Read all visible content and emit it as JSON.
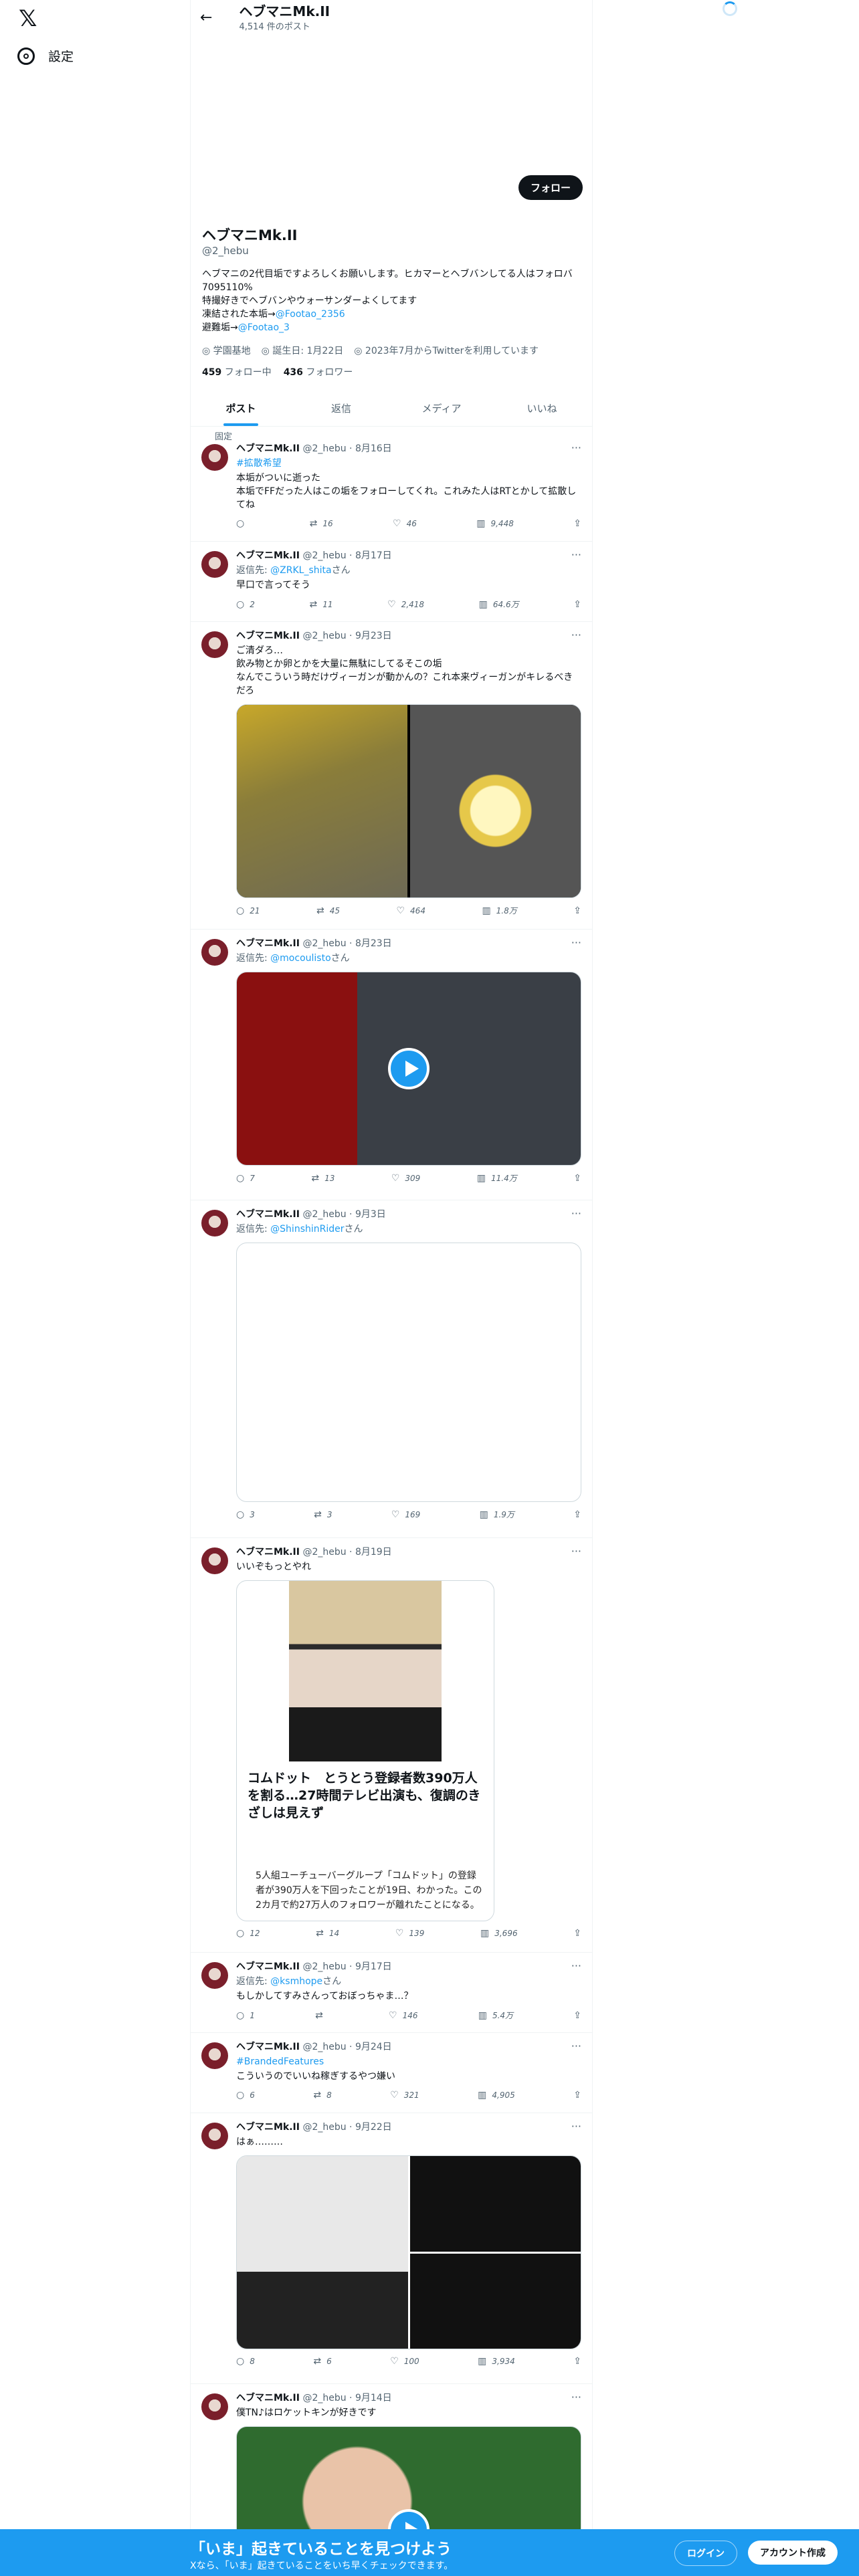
{
  "nav": {
    "logo": "𝕏",
    "settings": "設定"
  },
  "header": {
    "back": "←",
    "name": "ヘブマニMk.II",
    "count": "4,514 件のポスト"
  },
  "profile": {
    "follow": "フォロー",
    "name": "ヘブマニMk.II",
    "handle": "@2_hebu",
    "bio1": "ヘブマニの2代目垢ですよろしくお願いします。ヒカマーとヘブバンしてる人はフォロバ7095110%\n特撮好きでヘブバンやウォーサンダーよくしてます\n凍結された本垢→",
    "bio_link1": "@Footao_2356",
    "bio2": "避難垢→",
    "bio_link2": "@Footao_3",
    "loc": "学園基地",
    "born": "誕生日: 1月22日",
    "joined": "2023年7月からTwitterを利用しています",
    "following_num": "459",
    "following_label": "フォロー中",
    "followers_num": "436",
    "followers_label": "フォロワー"
  },
  "tabs": [
    "ポスト",
    "返信",
    "メディア",
    "いいね"
  ],
  "pinned": "固定",
  "tweets": [
    {
      "name": "ヘブマニMk.II",
      "meta": "@2_hebu · 8月16日",
      "hashtag": "#拡散希望",
      "text": "本垢がついに逝った\n本垢でFFだった人はこの垢をフォローしてくれ。これみた人はRTとかして拡散してね",
      "reply": "",
      "rt": "16",
      "like": "46",
      "view": "9,448"
    },
    {
      "name": "ヘブマニMk.II",
      "meta": "@2_hebu · 8月17日",
      "reply_to": "返信先: ",
      "reply_link": "@ZRKL_shita",
      "reply_suffix": "さん",
      "text": "早口で言ってそう",
      "reply": "2",
      "rt": "11",
      "like": "2,418",
      "view": "64.6万"
    },
    {
      "name": "ヘブマニMk.II",
      "meta": "@2_hebu · 9月23日",
      "text": "ご清ダろ…\n飲み物とか卵とかを大量に無駄にしてるそこの垢\nなんでこういう時だけヴィーガンが動かんの？これ本来ヴィーガンがキレるべきだろ",
      "reply": "21",
      "rt": "45",
      "like": "464",
      "view": "1.8万"
    },
    {
      "name": "ヘブマニMk.II",
      "meta": "@2_hebu · 8月23日",
      "reply_to": "返信先: ",
      "reply_link": "@mocoulisto",
      "reply_suffix": "さん",
      "text": "",
      "reply": "7",
      "rt": "13",
      "like": "309",
      "view": "11.4万"
    },
    {
      "name": "ヘブマニMk.II",
      "meta": "@2_hebu · 9月3日",
      "reply_to": "返信先: ",
      "reply_link": "@ShinshinRider",
      "reply_suffix": "さん",
      "text": "",
      "reply": "3",
      "rt": "3",
      "like": "169",
      "view": "1.9万"
    },
    {
      "name": "ヘブマニMk.II",
      "meta": "@2_hebu · 8月19日",
      "text": "いいぞもっとやれ",
      "card_title": "コムドット　とうとう登録者数390万人を割る…27時間テレビ出演も、復調のきざしは見えず",
      "card_body": "5人組ユーチューバーグループ「コムドット」の登録者が390万人を下回ったことが19日、わかった。この2カ月で約27万人のフォロワーが離れたことになる。",
      "reply": "12",
      "rt": "14",
      "like": "139",
      "view": "3,696"
    },
    {
      "name": "ヘブマニMk.II",
      "meta": "@2_hebu · 9月17日",
      "reply_to": "返信先: ",
      "reply_link": "@ksmhope",
      "reply_suffix": "さん",
      "text": "もしかしてすみさんっておぼっちゃま…？",
      "reply": "1",
      "rt": "",
      "like": "146",
      "view": "5.4万"
    },
    {
      "name": "ヘブマニMk.II",
      "meta": "@2_hebu · 9月24日",
      "hashtag": "#BrandedFeatures",
      "text": "こういうのでいいね稼ぎするやつ嫌い",
      "reply": "6",
      "rt": "8",
      "like": "321",
      "view": "4,905"
    },
    {
      "name": "ヘブマニMk.II",
      "meta": "@2_hebu · 9月22日",
      "text": "はぁ………",
      "reply": "8",
      "rt": "6",
      "like": "100",
      "view": "3,934"
    },
    {
      "name": "ヘブマニMk.II",
      "meta": "@2_hebu · 9月14日",
      "text": "僕TN♪はロケットキンが好きです",
      "reply": "",
      "rt": "",
      "like": "",
      "view": ""
    }
  ],
  "bottom": {
    "t1": "「いま」起きていることを見つけよう",
    "t2": "Xなら、「いま」起きていることをいち早くチェックできます。",
    "login": "ログイン",
    "signup": "アカウント作成"
  },
  "colors": {
    "accent": "#1d9bf0",
    "text": "#0f1419",
    "muted": "#536471"
  }
}
